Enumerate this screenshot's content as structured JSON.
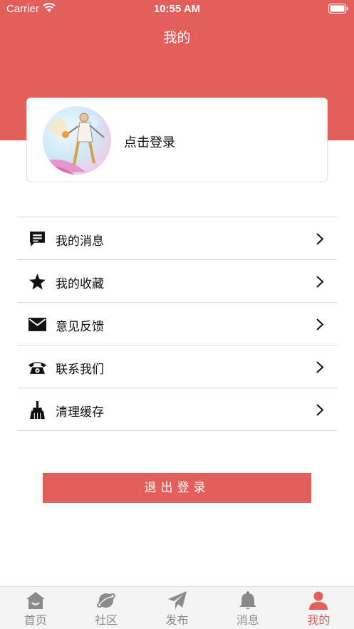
{
  "status_bar": {
    "carrier": "Carrier",
    "time": "10:55 AM"
  },
  "header": {
    "title": "我的"
  },
  "profile": {
    "login_prompt": "点击登录"
  },
  "menu": {
    "items": [
      {
        "label": "我的消息",
        "icon": "message-icon"
      },
      {
        "label": "我的收藏",
        "icon": "star-icon"
      },
      {
        "label": "意见反馈",
        "icon": "mail-icon"
      },
      {
        "label": "联系我们",
        "icon": "phone-icon"
      },
      {
        "label": "清理缓存",
        "icon": "broom-icon"
      }
    ]
  },
  "logout": {
    "label": "退出登录"
  },
  "tab_bar": {
    "tabs": [
      {
        "label": "首页",
        "icon": "home-icon"
      },
      {
        "label": "社区",
        "icon": "planet-icon"
      },
      {
        "label": "发布",
        "icon": "paper-plane-icon"
      },
      {
        "label": "消息",
        "icon": "bell-icon"
      },
      {
        "label": "我的",
        "icon": "user-icon",
        "active": true
      }
    ]
  },
  "colors": {
    "accent": "#e35f5b",
    "tab_inactive": "#8a8a8a"
  }
}
